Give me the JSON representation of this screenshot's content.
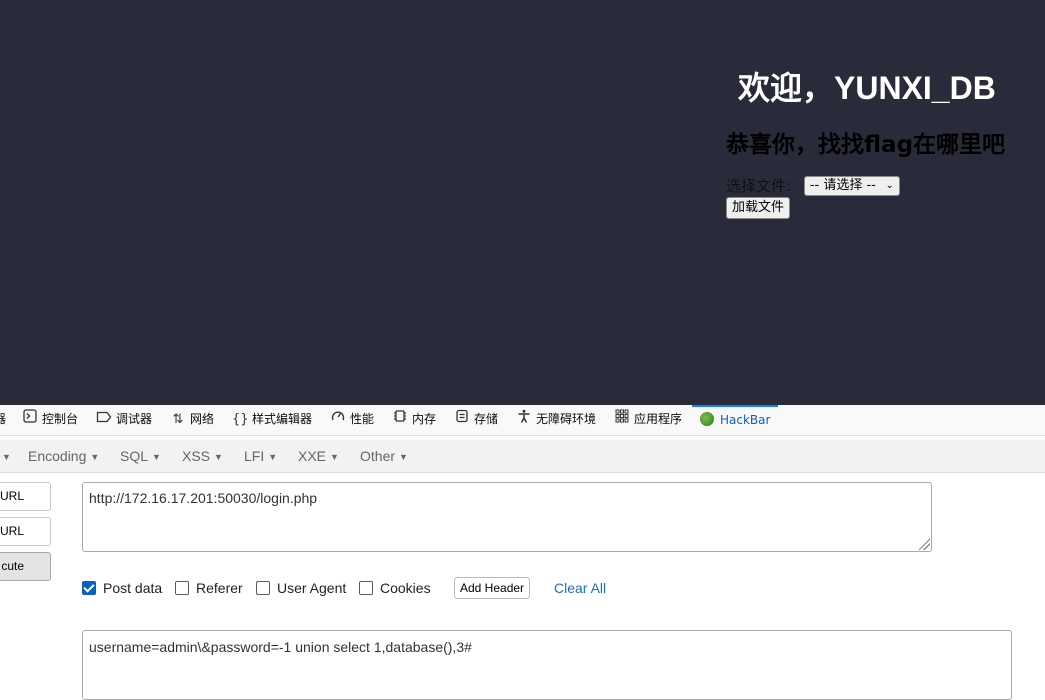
{
  "page": {
    "welcome": "欢迎，YUNXI_DB",
    "subtitle": "恭喜你，找找flag在哪里吧",
    "file_label": "选择文件:",
    "file_select_value": "-- 请选择 --",
    "load_button": "加载文件"
  },
  "devtools": {
    "tabs": [
      {
        "label": "器",
        "icon": "inspector-icon"
      },
      {
        "label": "控制台",
        "icon": "console-icon"
      },
      {
        "label": "调试器",
        "icon": "debugger-icon"
      },
      {
        "label": "网络",
        "icon": "network-icon"
      },
      {
        "label": "样式编辑器",
        "icon": "style-editor-icon"
      },
      {
        "label": "性能",
        "icon": "performance-icon"
      },
      {
        "label": "内存",
        "icon": "memory-icon"
      },
      {
        "label": "存储",
        "icon": "storage-icon"
      },
      {
        "label": "无障碍环境",
        "icon": "accessibility-icon"
      },
      {
        "label": "应用程序",
        "icon": "application-icon"
      },
      {
        "label": "HackBar",
        "icon": "hackbar-icon",
        "active": true
      }
    ]
  },
  "hackbar": {
    "menu": [
      "Encoding",
      "SQL",
      "XSS",
      "LFI",
      "XXE",
      "Other"
    ],
    "side_buttons": [
      "URL",
      "URL",
      "cute"
    ],
    "url_value": "http://172.16.17.201:50030/login.php",
    "options": {
      "post_data": {
        "label": "Post data",
        "checked": true
      },
      "referer": {
        "label": "Referer",
        "checked": false
      },
      "user_agent": {
        "label": "User Agent",
        "checked": false
      },
      "cookies": {
        "label": "Cookies",
        "checked": false
      }
    },
    "add_header": "Add Header",
    "clear_all": "Clear All",
    "post_value": "username=admin\\&password=-1 union select 1,database(),3#"
  },
  "colors": {
    "page_bg": "#2a2b3a",
    "accent": "#0a84ff",
    "link": "#1f6fbf"
  }
}
